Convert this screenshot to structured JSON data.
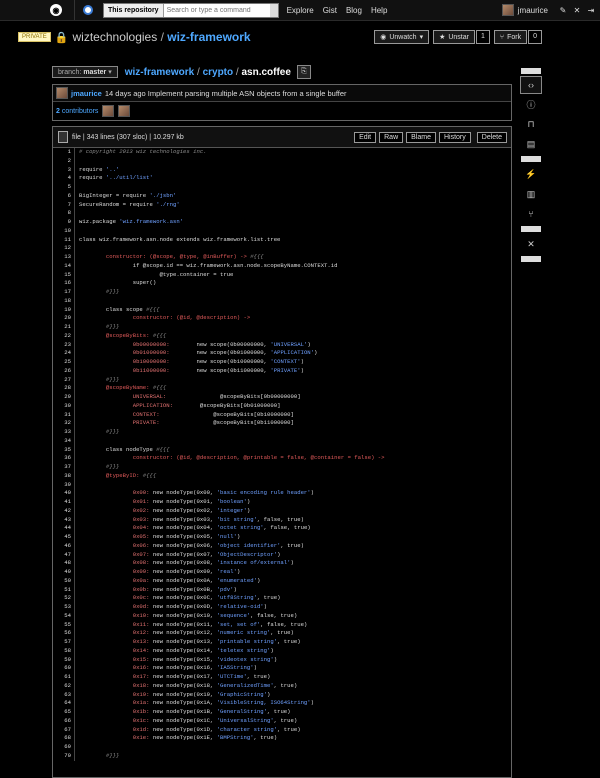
{
  "header": {
    "logo_glyph": "◉",
    "search_scope": "This repository",
    "search_placeholder": "Search or type a command",
    "nav": [
      "Explore",
      "Gist",
      "Blog",
      "Help"
    ],
    "username": "jmaurice",
    "icons": [
      "new-repo-icon",
      "settings-icon",
      "logout-icon"
    ],
    "icon_glyphs": [
      "✎",
      "✕",
      "⇥"
    ]
  },
  "repo": {
    "badge": "PRIVATE",
    "owner": "wiztechnologies",
    "separator": "/",
    "name": "wiz-framework",
    "unwatch_label": "Unwatch",
    "unstar_label": "Unstar",
    "unstar_count": "1",
    "fork_label": "Fork",
    "fork_count": "0"
  },
  "path": {
    "branch_prefix": "branch:",
    "branch": "master",
    "crumbs": [
      "wiz-framework",
      "crypto"
    ],
    "current": "asn.coffee",
    "sep": "/"
  },
  "commit": {
    "author": "jmaurice",
    "message": "14 days ago Implement parsing multiple ASN objects from a single buffer",
    "contributors_count": "2",
    "contributors_label": "contributors"
  },
  "file": {
    "meta": "file | 343 lines (307 sloc) | 10.297 kb",
    "buttons": [
      "Edit",
      "Raw",
      "Blame",
      "History"
    ],
    "delete_label": "Delete"
  },
  "code_lines": [
    "# copyright 2013 wiz technologies inc.",
    "",
    "require '..'",
    "require '../util/list'",
    "",
    "BigInteger = require './jsbn'",
    "SecureRandom = require './rng'",
    "",
    "wiz.package 'wiz.framework.asn'",
    "",
    "class wiz.framework.asn.node extends wiz.framework.list.tree",
    "",
    "\tconstructor: (@scope, @type, @inBuffer) -> #{{{",
    "\t\tif @scope.id == wiz.framework.asn.node.scopeByName.CONTEXT.id",
    "\t\t\t@type.container = true",
    "\t\tsuper()",
    "\t#}}}",
    "",
    "\tclass scope #{{{",
    "\t\tconstructor: (@id, @description) ->",
    "\t#}}}",
    "\t@scopeByBits: #{{{",
    "\t\t0b00000000:\tnew scope(0b00000000, 'UNIVERSAL')",
    "\t\t0b01000000:\tnew scope(0b01000000, 'APPLICATION')",
    "\t\t0b10000000:\tnew scope(0b10000000, 'CONTEXT')",
    "\t\t0b11000000:\tnew scope(0b11000000, 'PRIVATE')",
    "\t#}}}",
    "\t@scopeByName: #{{{",
    "\t\tUNIVERSAL:\t\t@scopeByBits[0b00000000]",
    "\t\tAPPLICATION:\t@scopeByBits[0b01000000]",
    "\t\tCONTEXT:\t\t@scopeByBits[0b10000000]",
    "\t\tPRIVATE:\t\t@scopeByBits[0b11000000]",
    "\t#}}}",
    "",
    "\tclass nodeType #{{{",
    "\t\tconstructor: (@id, @description, @printable = false, @container = false) ->",
    "\t#}}}",
    "\t@typeByID: #{{{",
    "",
    "\t\t0x00: new nodeType(0x00, 'basic encoding rule header')",
    "\t\t0x01: new nodeType(0x01, 'boolean')",
    "\t\t0x02: new nodeType(0x02, 'integer')",
    "\t\t0x03: new nodeType(0x03, 'bit string', false, true)",
    "\t\t0x04: new nodeType(0x04, 'octet string', false, true)",
    "\t\t0x05: new nodeType(0x05, 'null')",
    "\t\t0x06: new nodeType(0x06, 'object identifier', true)",
    "\t\t0x07: new nodeType(0x07, 'ObjectDescriptor')",
    "\t\t0x08: new nodeType(0x08, 'instance of/external')",
    "\t\t0x09: new nodeType(0x09, 'real')",
    "\t\t0x0a: new nodeType(0x0A, 'enumerated')",
    "\t\t0x0b: new nodeType(0x0B, 'pdv')",
    "\t\t0x0c: new nodeType(0x0C, 'utf8String', true)",
    "\t\t0x0d: new nodeType(0x0D, 'relative-oid')",
    "\t\t0x10: new nodeType(0x10, 'sequence', false, true)",
    "\t\t0x11: new nodeType(0x11, 'set, set of', false, true)",
    "\t\t0x12: new nodeType(0x12, 'numeric string', true)",
    "\t\t0x13: new nodeType(0x13, 'printable string', true)",
    "\t\t0x14: new nodeType(0x14, 'teletex string')",
    "\t\t0x15: new nodeType(0x15, 'videotex string')",
    "\t\t0x16: new nodeType(0x16, 'IA5String')",
    "\t\t0x17: new nodeType(0x17, 'UTCTime', true)",
    "\t\t0x18: new nodeType(0x18, 'GeneralizedTime', true)",
    "\t\t0x19: new nodeType(0x19, 'GraphicString')",
    "\t\t0x1a: new nodeType(0x1A, 'VisibleString, ISO64String')",
    "\t\t0x1b: new nodeType(0x1B, 'GeneralString', true)",
    "\t\t0x1c: new nodeType(0x1C, 'UniversalString', true)",
    "\t\t0x1d: new nodeType(0x1D, 'character string', true)",
    "\t\t0x1e: new nodeType(0x1E, 'BMPString', true)",
    "",
    "\t#}}}"
  ],
  "sidenav": [
    {
      "name": "code-icon",
      "glyph": "‹›"
    },
    {
      "name": "issues-icon",
      "glyph": "ⓘ"
    },
    {
      "name": "pull-requests-icon",
      "glyph": "⊓"
    },
    {
      "name": "wiki-icon",
      "glyph": "▤"
    },
    {
      "name": "pulse-icon",
      "glyph": "⚡"
    },
    {
      "name": "graphs-icon",
      "glyph": "▥"
    },
    {
      "name": "network-icon",
      "glyph": "⑂"
    },
    {
      "name": "settings-icon",
      "glyph": "✕"
    }
  ]
}
